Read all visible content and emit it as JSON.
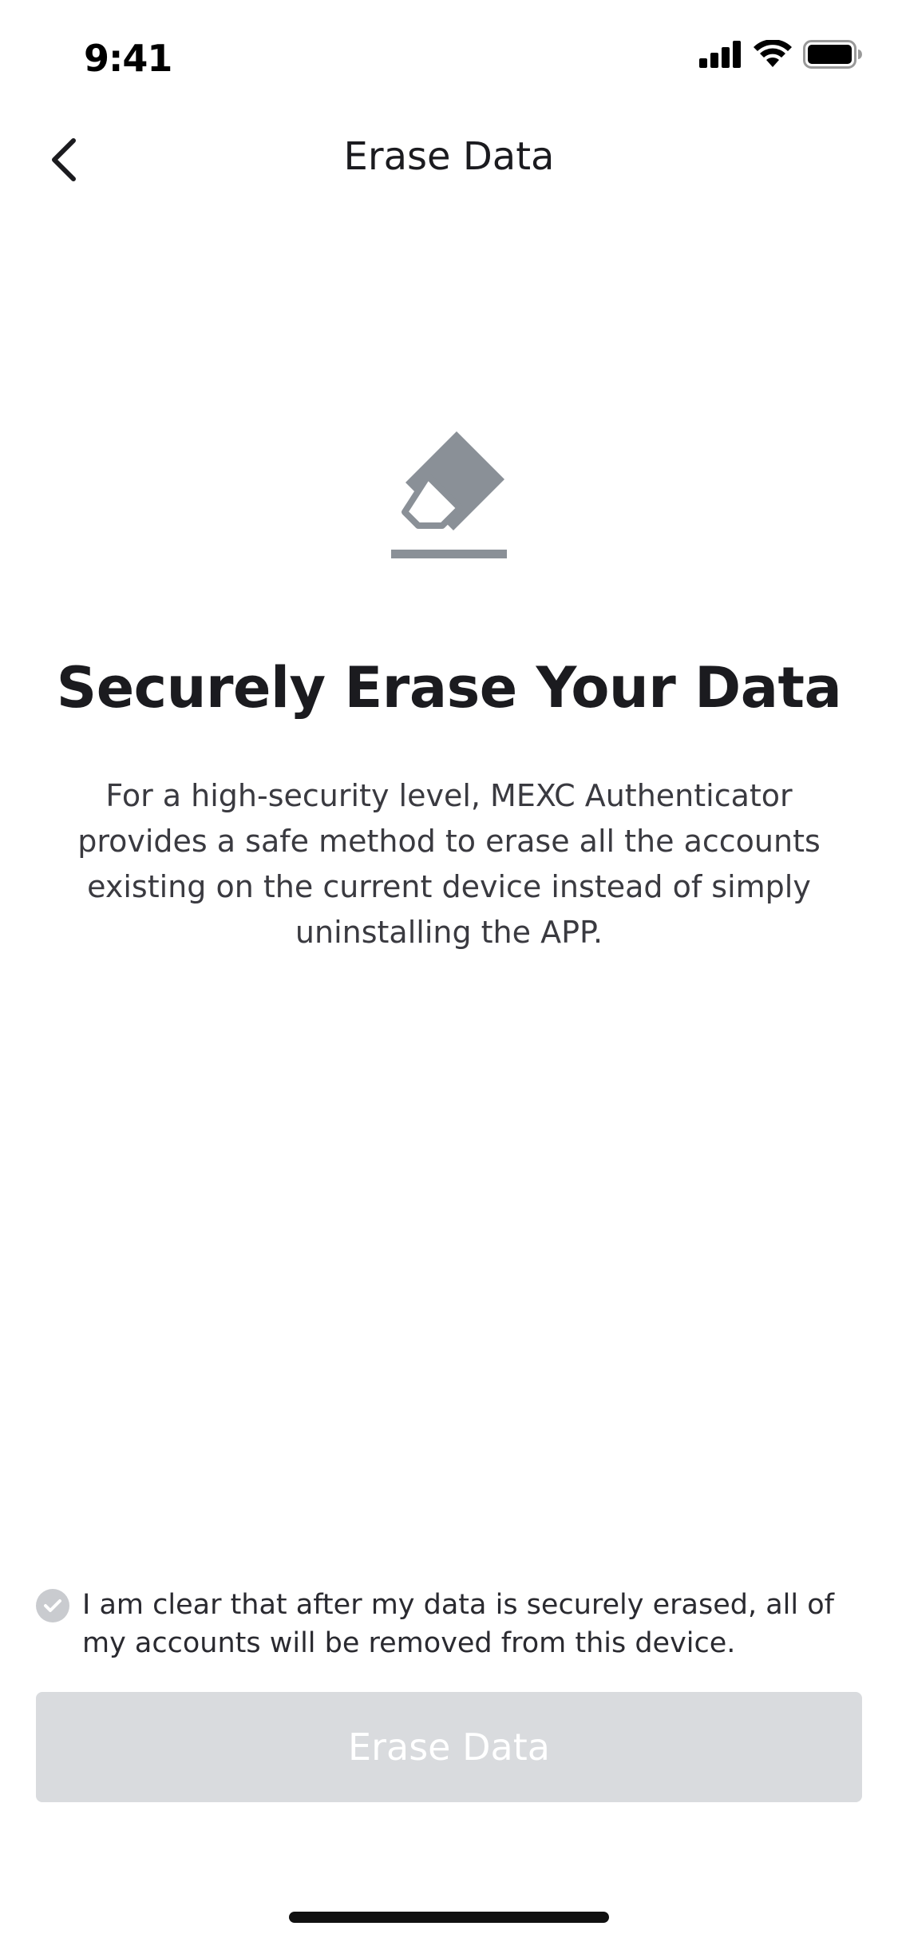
{
  "status_bar": {
    "time": "9:41"
  },
  "nav": {
    "title": "Erase Data"
  },
  "content": {
    "headline": "Securely Erase Your Data",
    "description": "For a high-security level, MEXC Authenticator provides a safe method to erase all the accounts existing on the current device instead of simply uninstalling the APP."
  },
  "agreement": {
    "text": "I am clear that after my data is securely erased, all of my accounts will be removed from this device.",
    "checked": false
  },
  "button": {
    "label": "Erase Data",
    "enabled": false
  },
  "colors": {
    "icon_gray": "#8a9097",
    "button_disabled": "#d9dbde",
    "checkbox_gray": "#c9cbcf"
  },
  "icons": {
    "back": "chevron-left-icon",
    "illustration": "eraser-icon",
    "checkbox": "check-icon"
  }
}
